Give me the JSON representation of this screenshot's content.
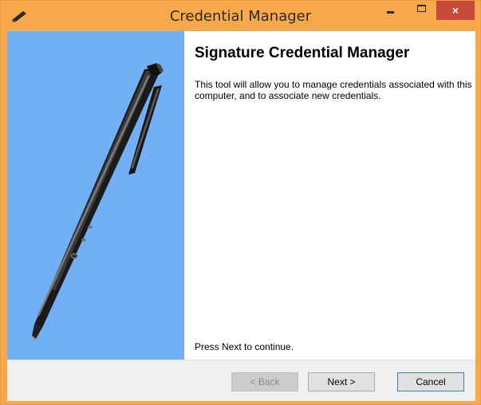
{
  "window": {
    "title": "Credential Manager",
    "close_glyph": "×"
  },
  "content": {
    "heading": "Signature Credential Manager",
    "description": "This tool will allow you to manage credentials associated with this computer, and to associate new credentials.",
    "prompt": "Press Next to continue."
  },
  "buttons": {
    "back": "< Back",
    "next": "Next >",
    "cancel": "Cancel"
  },
  "icons": [
    "pen-icon",
    "minimize-icon",
    "maximize-icon",
    "close-icon",
    "stylus-image"
  ],
  "colors": {
    "titlebar": "#f7a84a",
    "banner": "#71b0f4",
    "close": "#c7493a"
  }
}
